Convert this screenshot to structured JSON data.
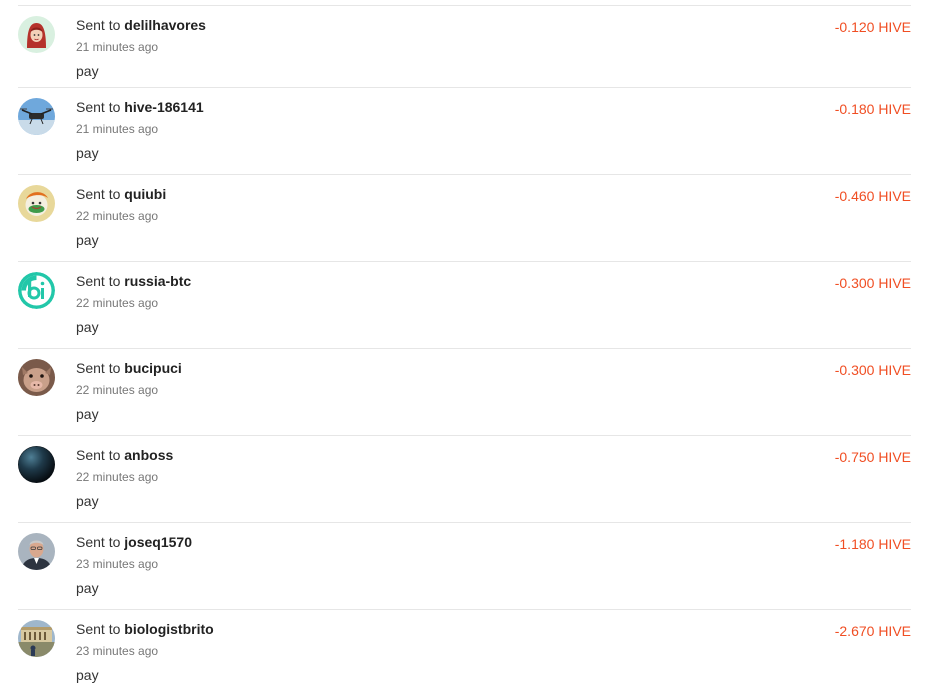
{
  "transfers": [
    {
      "prefix": "Sent to",
      "user": "delilhavores",
      "time": "21 minutes ago",
      "memo": "pay",
      "amount": "-0.120 HIVE",
      "avatar": "red-hood-avatar"
    },
    {
      "prefix": "Sent to",
      "user": "hive-186141",
      "time": "21 minutes ago",
      "memo": "pay",
      "amount": "-0.180 HIVE",
      "avatar": "drone-avatar"
    },
    {
      "prefix": "Sent to",
      "user": "quiubi",
      "time": "22 minutes ago",
      "memo": "pay",
      "amount": "-0.460 HIVE",
      "avatar": "cartoon-avatar"
    },
    {
      "prefix": "Sent to",
      "user": "russia-btc",
      "time": "22 minutes ago",
      "memo": "pay",
      "amount": "-0.300 HIVE",
      "avatar": "bi-logo-avatar"
    },
    {
      "prefix": "Sent to",
      "user": "bucipuci",
      "time": "22 minutes ago",
      "memo": "pay",
      "amount": "-0.300 HIVE",
      "avatar": "pig-avatar"
    },
    {
      "prefix": "Sent to",
      "user": "anboss",
      "time": "22 minutes ago",
      "memo": "pay",
      "amount": "-0.750 HIVE",
      "avatar": "planet-avatar"
    },
    {
      "prefix": "Sent to",
      "user": "joseq1570",
      "time": "23 minutes ago",
      "memo": "pay",
      "amount": "-1.180 HIVE",
      "avatar": "man-portrait-avatar"
    },
    {
      "prefix": "Sent to",
      "user": "biologistbrito",
      "time": "23 minutes ago",
      "memo": "pay",
      "amount": "-2.670 HIVE",
      "avatar": "building-avatar"
    }
  ],
  "colors": {
    "amount_negative": "#f04e23",
    "separator": "#e6e6e6"
  }
}
